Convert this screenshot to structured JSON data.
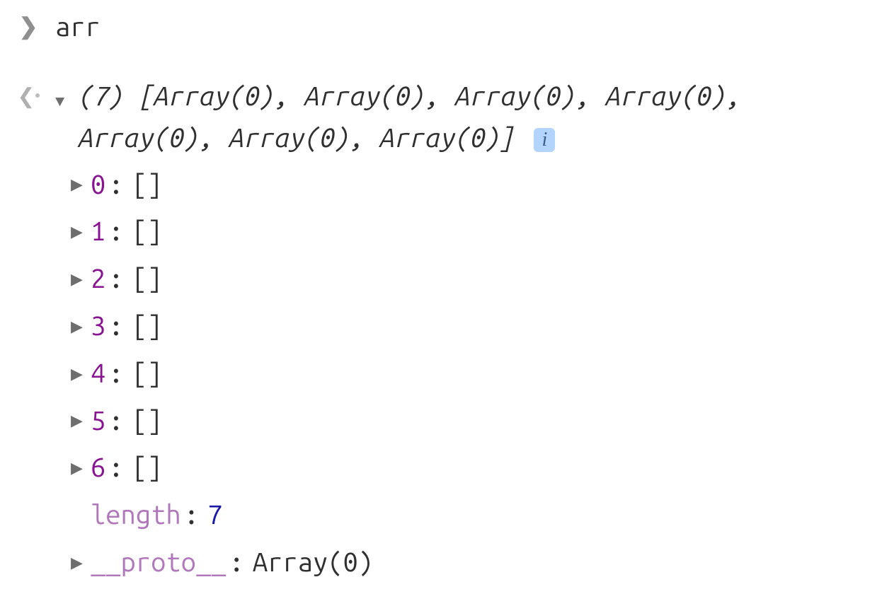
{
  "input": {
    "text": "arr"
  },
  "output": {
    "summary_prefix": "(7) ",
    "summary_body": "[Array(0), Array(0), Array(0), Array(0), Array(0), Array(0), Array(0)]",
    "info_badge": "i",
    "properties": [
      {
        "key": "0",
        "value": "[]",
        "expandable": true,
        "key_style": "index"
      },
      {
        "key": "1",
        "value": "[]",
        "expandable": true,
        "key_style": "index"
      },
      {
        "key": "2",
        "value": "[]",
        "expandable": true,
        "key_style": "index"
      },
      {
        "key": "3",
        "value": "[]",
        "expandable": true,
        "key_style": "index"
      },
      {
        "key": "4",
        "value": "[]",
        "expandable": true,
        "key_style": "index"
      },
      {
        "key": "5",
        "value": "[]",
        "expandable": true,
        "key_style": "index"
      },
      {
        "key": "6",
        "value": "[]",
        "expandable": true,
        "key_style": "index"
      }
    ],
    "length_key": "length",
    "length_value": "7",
    "proto_key": "__proto__",
    "proto_value": "Array(0)"
  },
  "glyphs": {
    "input_prompt": "❯",
    "output_prompt": "❮",
    "triangle_down": "▼",
    "triangle_right": "▶"
  }
}
